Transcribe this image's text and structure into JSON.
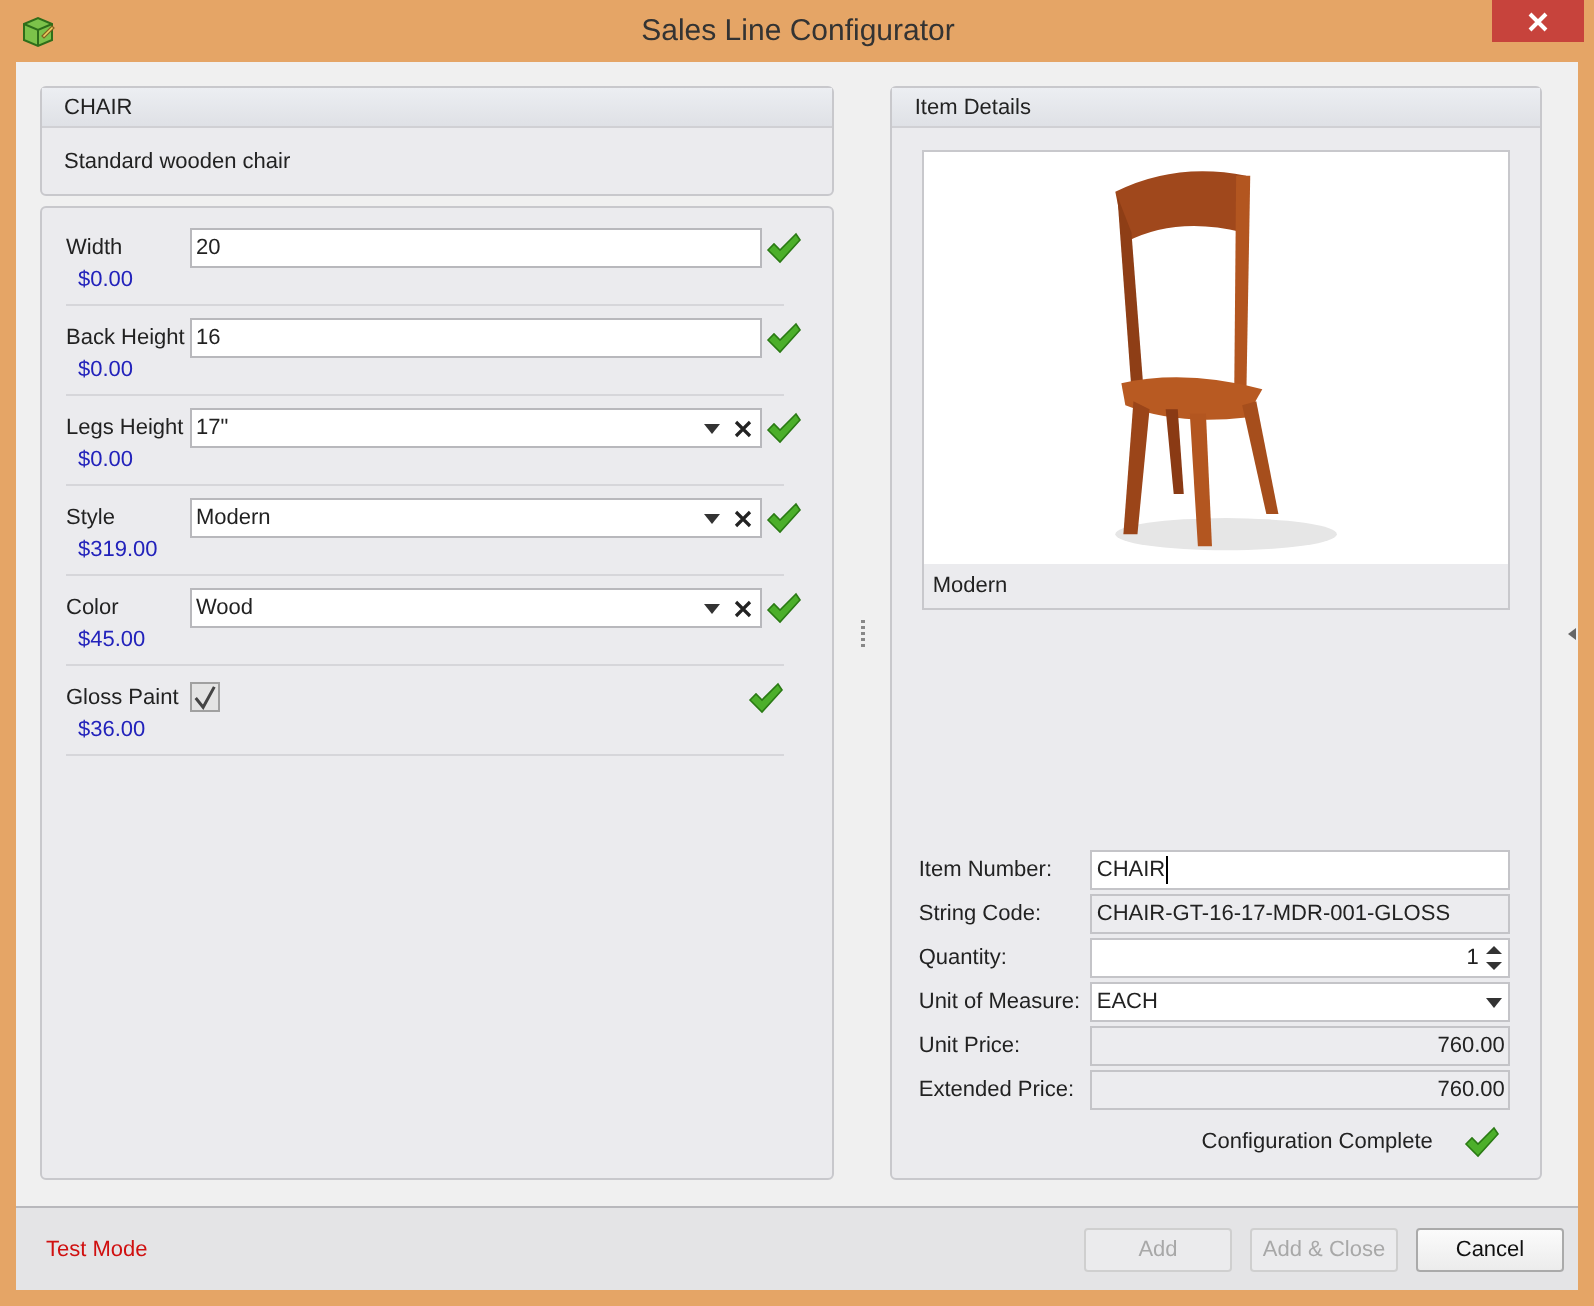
{
  "window": {
    "title": "Sales Line Configurator"
  },
  "item": {
    "name": "CHAIR",
    "description": "Standard wooden chair"
  },
  "options": [
    {
      "kind": "text",
      "label": "Width",
      "value": "20",
      "price": "$0.00",
      "valid": true
    },
    {
      "kind": "text",
      "label": "Back Height",
      "value": "16",
      "price": "$0.00",
      "valid": true
    },
    {
      "kind": "combo",
      "label": "Legs Height",
      "value": "17\"",
      "price": "$0.00",
      "valid": true
    },
    {
      "kind": "combo",
      "label": "Style",
      "value": "Modern",
      "price": "$319.00",
      "valid": true
    },
    {
      "kind": "combo",
      "label": "Color",
      "value": "Wood",
      "price": "$45.00",
      "valid": true
    },
    {
      "kind": "checkbox",
      "label": "Gloss Paint",
      "checked": true,
      "price": "$36.00",
      "valid": true
    }
  ],
  "details": {
    "title": "Item Details",
    "image_caption": "Modern",
    "fields": [
      {
        "kind": "input",
        "label": "Item Number:",
        "value": "CHAIR"
      },
      {
        "kind": "readonly",
        "label": "String Code:",
        "value": "CHAIR-GT-16-17-MDR-001-GLOSS"
      },
      {
        "kind": "spin",
        "label": "Quantity:",
        "value": "1"
      },
      {
        "kind": "combo",
        "label": "Unit of Measure:",
        "value": "EACH"
      },
      {
        "kind": "amount",
        "label": "Unit Price:",
        "value": "760.00"
      },
      {
        "kind": "amount",
        "label": "Extended Price:",
        "value": "760.00"
      }
    ]
  },
  "status": {
    "text": "Configuration Complete",
    "complete": true
  },
  "footer": {
    "mode": "Test Mode",
    "buttons": [
      {
        "label": "Add",
        "disabled": true
      },
      {
        "label": "Add & Close",
        "disabled": true
      },
      {
        "label": "Cancel",
        "disabled": false
      }
    ]
  }
}
